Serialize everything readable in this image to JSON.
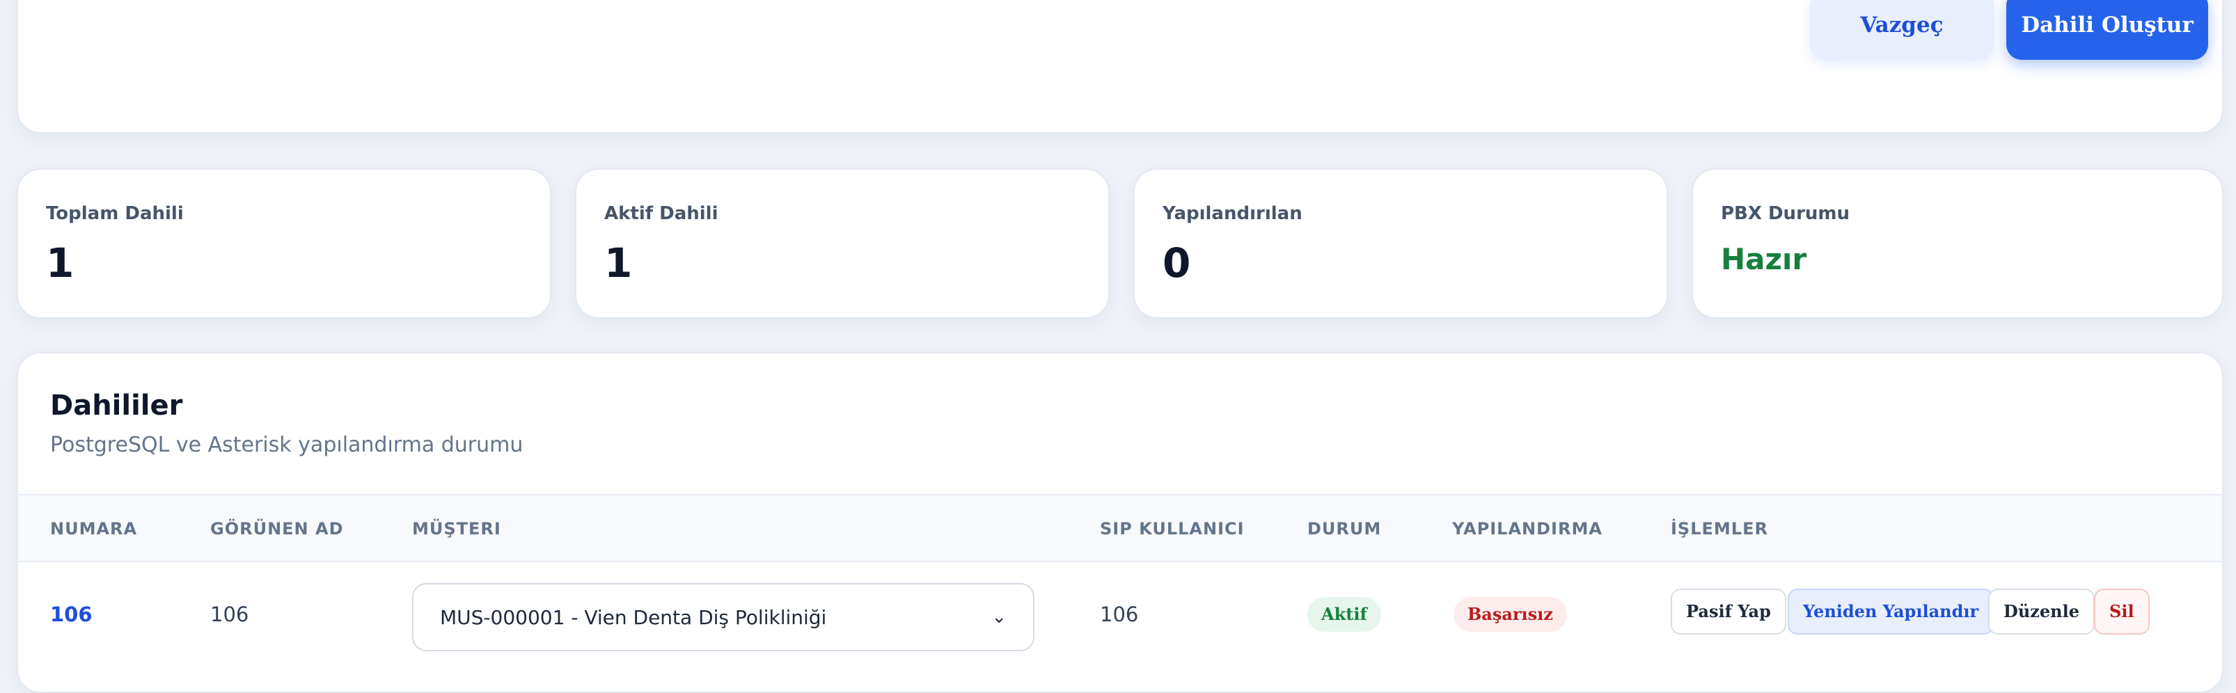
{
  "form": {
    "cancel_label": "Vazgeç",
    "create_label": "Dahili Oluştur"
  },
  "stats": [
    {
      "label": "Toplam Dahili",
      "value": "1"
    },
    {
      "label": "Aktif Dahili",
      "value": "1"
    },
    {
      "label": "Yapılandırılan",
      "value": "0"
    },
    {
      "label": "PBX Durumu",
      "value": "Hazır"
    }
  ],
  "table": {
    "title": "Dahililer",
    "subtitle": "PostgreSQL ve Asterisk yapılandırma durumu",
    "columns": [
      "NUMARA",
      "GÖRÜNEN AD",
      "MÜŞTERI",
      "SIP KULLANICI",
      "DURUM",
      "YAPILANDIRMA",
      "İŞLEMLER"
    ],
    "rows": [
      {
        "number": "106",
        "display_name": "106",
        "customer": "MUS-000001 - Vien Denta Diş Polikliniği",
        "sip_user": "106",
        "status": "Aktif",
        "config": "Başarısız",
        "actions": [
          "Pasif Yap",
          "Yeniden Yapılandır",
          "Düzenle",
          "Sil"
        ]
      }
    ]
  },
  "colors": {
    "accent": "#2563eb",
    "success": "#15803d",
    "danger": "#b91c1c"
  }
}
